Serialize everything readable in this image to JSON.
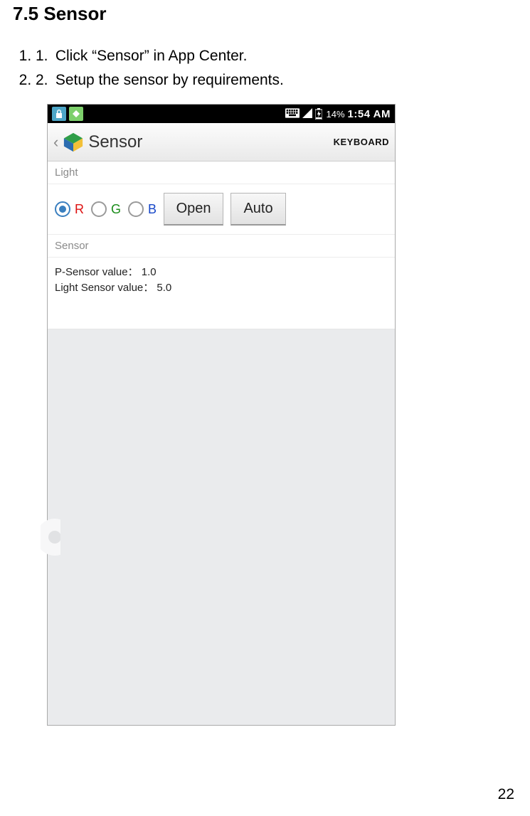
{
  "heading": "7.5 Sensor",
  "steps": {
    "1": "Click “Sensor” in App Center.",
    "2": "Setup the sensor by requirements."
  },
  "statusbar": {
    "battery_pct": "14%",
    "time": "1:54 AM"
  },
  "app": {
    "title": "Sensor",
    "keyboard_label": "KEYBOARD"
  },
  "sections": {
    "light_label": "Light",
    "sensor_label": "Sensor"
  },
  "light": {
    "r": "R",
    "g": "G",
    "b": "B",
    "selected": "R",
    "open_btn": "Open",
    "auto_btn": "Auto"
  },
  "values": {
    "p_sensor_label": "P-Sensor value：",
    "p_sensor_value": "1.0",
    "light_sensor_label": "Light Sensor value：",
    "light_sensor_value": "5.0"
  },
  "page_number": "22",
  "colors": {
    "accent_blue": "#3a7fbf",
    "status_teal": "#4da6c7",
    "status_green": "#7dd06b",
    "blank_bg": "#eaebed"
  }
}
